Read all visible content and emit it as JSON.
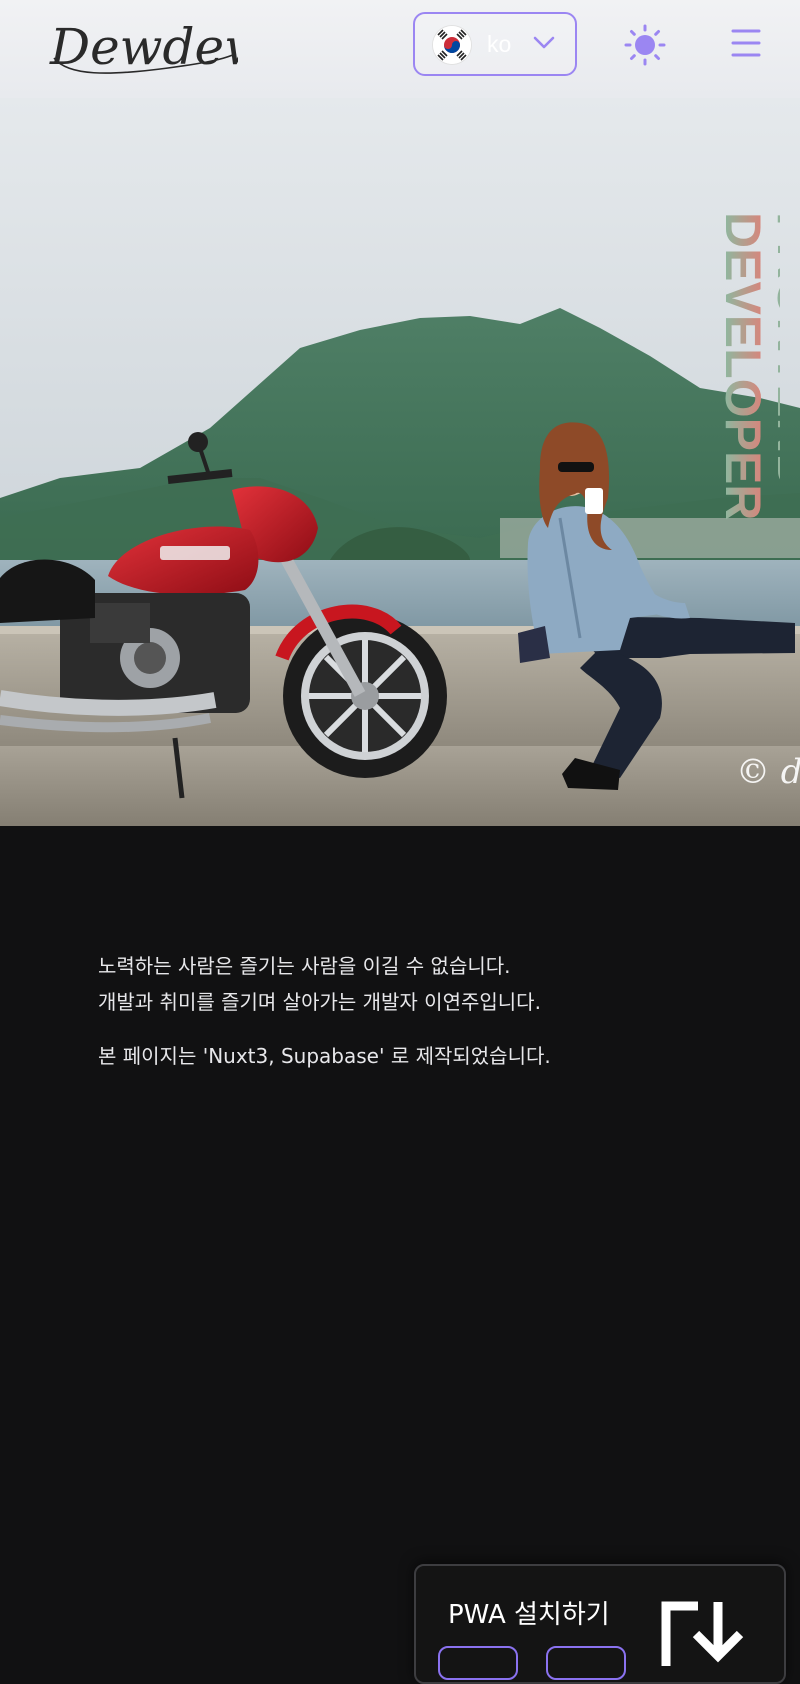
{
  "header": {
    "logo_text": "Dewdew",
    "language": {
      "code": "ko",
      "flag": "south-korea-flag"
    },
    "icons": {
      "theme_toggle": "sun-icon",
      "menu": "hamburger-menu-icon",
      "dropdown": "chevron-down-icon"
    }
  },
  "hero": {
    "title_line1": "FRONTEND",
    "title_line2": "DEVELOPER",
    "watermark": "© d",
    "image": "person sitting on seawall beside red motorcycle, mountains and sea behind"
  },
  "intro": {
    "line1": "노력하는 사람은 즐기는 사람을 이길 수 없습니다.",
    "line2": "개발과 취미를 즐기며 살아가는 개발자 이연주입니다.",
    "built_with": "본 페이지는 'Nuxt3, Supabase' 로 제작되었습니다."
  },
  "pwa": {
    "title": "PWA 설치하기",
    "icon": "download-install-icon"
  },
  "colors": {
    "accent": "#9b86f2",
    "page_bg": "#111112",
    "header_bg": "#f1f2f4",
    "title_gradient_start": "#e97973",
    "title_gradient_end": "#7cc4a8"
  }
}
